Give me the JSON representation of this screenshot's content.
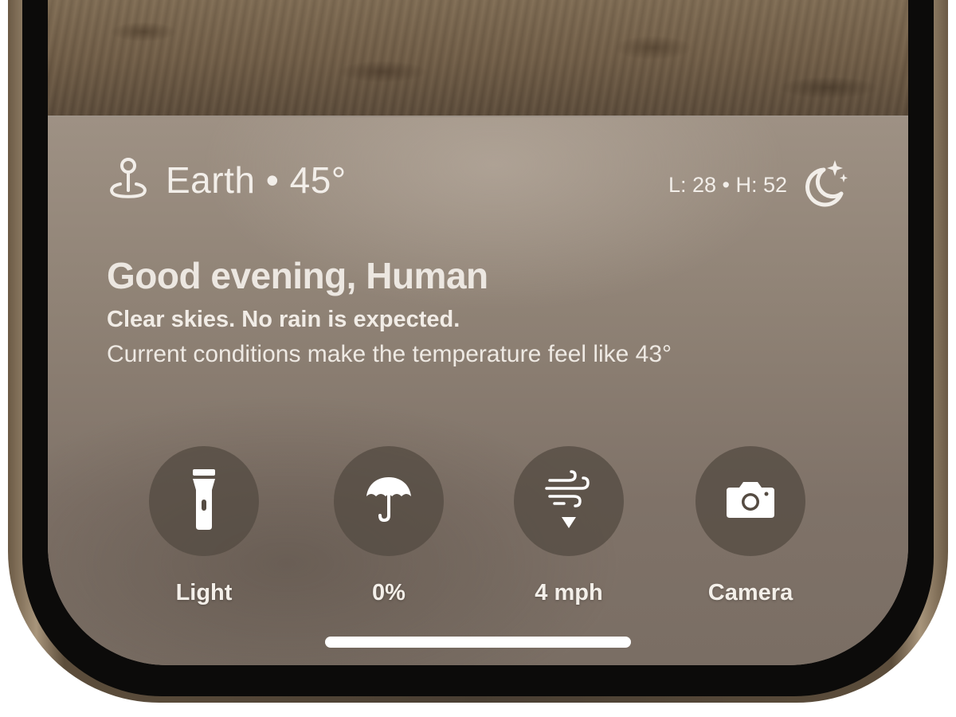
{
  "location": {
    "name_temp": "Earth • 45°",
    "icon": "location-pin-icon"
  },
  "range": {
    "text": "L: 28 • H: 52",
    "icon": "moon-stars-icon"
  },
  "greeting": "Good evening, Human",
  "summary": "Clear skies. No rain is expected.",
  "detail": "Current conditions make the temperature feel like 43°",
  "controls": [
    {
      "label": "Light",
      "icon": "flashlight-icon"
    },
    {
      "label": "0%",
      "icon": "umbrella-icon"
    },
    {
      "label": "4 mph",
      "icon": "wind-icon"
    },
    {
      "label": "Camera",
      "icon": "camera-icon"
    }
  ],
  "colors": {
    "panel": "#8f8275",
    "button": "#554b42",
    "text": "#f2eee9",
    "frame": "#5c4d3b"
  }
}
